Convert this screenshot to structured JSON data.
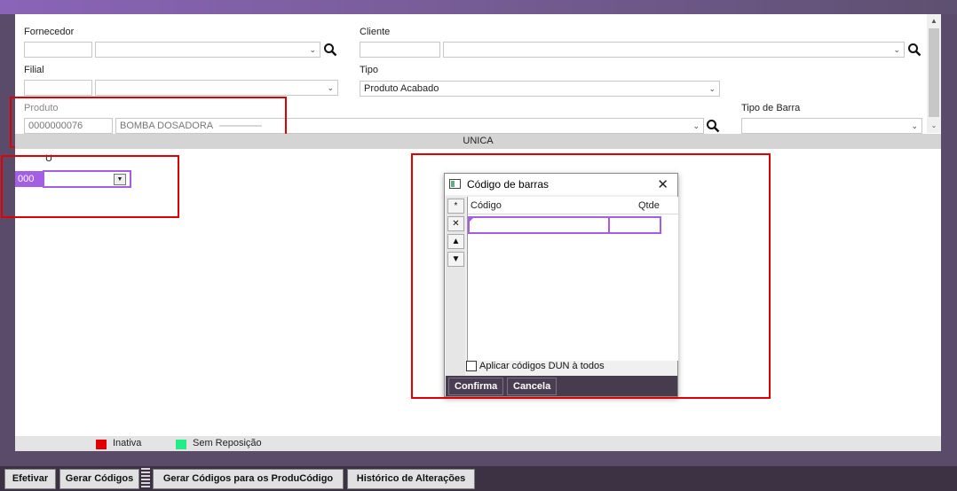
{
  "form": {
    "fornecedor_label": "Fornecedor",
    "cliente_label": "Cliente",
    "filial_label": "Filial",
    "tipo_label": "Tipo",
    "tipo_value": "Produto Acabado",
    "produto_label": "Produto",
    "produto_code": "0000000076",
    "produto_name": "BOMBA DOSADORA",
    "tipo_barra_label": "Tipo de Barra"
  },
  "grid_header": {
    "column": "UNICA",
    "row_header": "U"
  },
  "grid_cell": {
    "value": "000"
  },
  "dialog": {
    "title": "Código de barras",
    "close": "✕",
    "col_codigo": "Código",
    "col_qtde": "Qtde",
    "side_buttons": [
      "*",
      "✕",
      "▲",
      "▼"
    ],
    "checkbox_label": "Aplicar códigos DUN à todos",
    "confirm_label": "Confirma",
    "cancel_label": "Cancela"
  },
  "legend": {
    "inativa": "Inativa",
    "sem_reposicao": "Sem Reposição",
    "inativa_color": "#e00000",
    "sem_reposicao_color": "#22ee88"
  },
  "toolbar": {
    "efetivar": "Efetivar",
    "gerar_codigos": "Gerar Códigos",
    "gerar_codigos_produtos": "Gerar Códigos para os ProduCódigo",
    "historico": "Histórico de Alterações"
  },
  "colors": {
    "accent": "#a45ee6",
    "highlight": "#e00000"
  }
}
